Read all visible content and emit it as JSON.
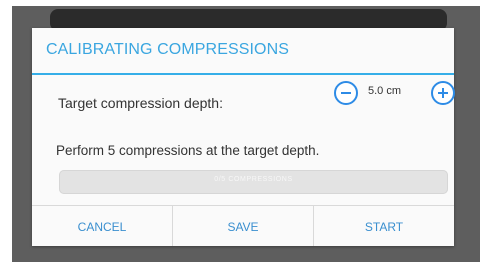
{
  "dialog": {
    "title": "CALIBRATING COMPRESSIONS",
    "depth_label": "Target compression depth:",
    "depth_value": "5.0 cm",
    "instruction": "Perform 5 compressions at the target depth.",
    "progress_text": "0/5 COMPRESSIONS",
    "progress_fraction": 0,
    "buttons": {
      "cancel": "CANCEL",
      "save": "SAVE",
      "start": "START"
    },
    "icons": {
      "decrease": "minus-circle-icon",
      "increase": "plus-circle-icon"
    },
    "colors": {
      "accent": "#35aee8",
      "button_blue": "#2d8be6"
    }
  }
}
